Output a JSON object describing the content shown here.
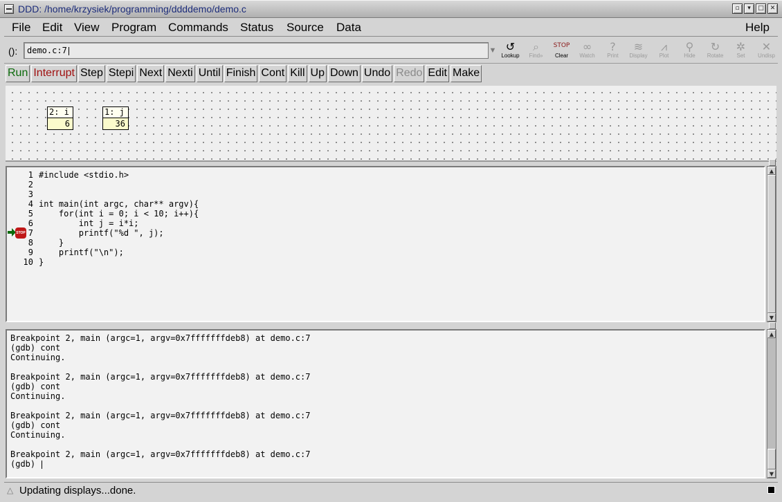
{
  "window": {
    "title": "DDD: /home/krzysiek/programming/ddddemo/demo.c",
    "controls": [
      "▫",
      "▾",
      "□",
      "✕"
    ]
  },
  "menubar": {
    "left": [
      "File",
      "Edit",
      "View",
      "Program",
      "Commands",
      "Status",
      "Source",
      "Data"
    ],
    "help": "Help"
  },
  "argument": {
    "label": "():",
    "value": "demo.c:7"
  },
  "tool_icons": [
    {
      "name": "lookup-icon",
      "glyph": "↺",
      "label": "Lookup",
      "enabled": true
    },
    {
      "name": "find-icon",
      "glyph": "⌕",
      "label": "Find»",
      "enabled": false
    },
    {
      "name": "clear-icon",
      "glyph": "STOP",
      "label": "Clear",
      "enabled": true
    },
    {
      "name": "watch-icon",
      "glyph": "∞",
      "label": "Watch",
      "enabled": false
    },
    {
      "name": "print-icon",
      "glyph": "?",
      "label": "Print",
      "enabled": false
    },
    {
      "name": "display-icon",
      "glyph": "≋",
      "label": "Display",
      "enabled": false
    },
    {
      "name": "plot-icon",
      "glyph": "⩘",
      "label": "Plot",
      "enabled": false
    },
    {
      "name": "hide-icon",
      "glyph": "⚲",
      "label": "Hide",
      "enabled": false
    },
    {
      "name": "rotate-icon",
      "glyph": "↻",
      "label": "Rotate",
      "enabled": false
    },
    {
      "name": "set-icon",
      "glyph": "✲",
      "label": "Set",
      "enabled": false
    },
    {
      "name": "undisp-icon",
      "glyph": "✕",
      "label": "Undisp",
      "enabled": false
    }
  ],
  "command_buttons": [
    {
      "label": "Run",
      "style": "run"
    },
    {
      "label": "Interrupt",
      "style": "interrupt"
    },
    {
      "label": "Step",
      "style": ""
    },
    {
      "label": "Stepi",
      "style": ""
    },
    {
      "label": "Next",
      "style": ""
    },
    {
      "label": "Nexti",
      "style": ""
    },
    {
      "label": "Until",
      "style": ""
    },
    {
      "label": "Finish",
      "style": ""
    },
    {
      "label": "Cont",
      "style": ""
    },
    {
      "label": "Kill",
      "style": ""
    },
    {
      "label": "Up",
      "style": ""
    },
    {
      "label": "Down",
      "style": ""
    },
    {
      "label": "Undo",
      "style": ""
    },
    {
      "label": "Redo",
      "style": "disabled"
    },
    {
      "label": "Edit",
      "style": ""
    },
    {
      "label": "Make",
      "style": ""
    }
  ],
  "displays": [
    {
      "header": "2: i",
      "value": "6"
    },
    {
      "header": "1: j",
      "value": "36"
    }
  ],
  "source": {
    "lines": [
      {
        "num": "1",
        "text": "#include <stdio.h>"
      },
      {
        "num": "2",
        "text": ""
      },
      {
        "num": "3",
        "text": ""
      },
      {
        "num": "4",
        "text": "int main(int argc, char** argv){"
      },
      {
        "num": "5",
        "text": "    for(int i = 0; i < 10; i++){"
      },
      {
        "num": "6",
        "text": "        int j = i*i;"
      },
      {
        "num": "7",
        "text": "        printf(\"%d \", j);"
      },
      {
        "num": "8",
        "text": "    }"
      },
      {
        "num": "9",
        "text": "    printf(\"\\n\");"
      },
      {
        "num": "10",
        "text": "}"
      }
    ],
    "breakpoint_label": "STOP"
  },
  "gdb_console": {
    "lines": [
      "Breakpoint 2, main (argc=1, argv=0x7fffffffdeb8) at demo.c:7",
      "(gdb) cont",
      "Continuing.",
      "",
      "Breakpoint 2, main (argc=1, argv=0x7fffffffdeb8) at demo.c:7",
      "(gdb) cont",
      "Continuing.",
      "",
      "Breakpoint 2, main (argc=1, argv=0x7fffffffdeb8) at demo.c:7",
      "(gdb) cont",
      "Continuing.",
      "",
      "Breakpoint 2, main (argc=1, argv=0x7fffffffdeb8) at demo.c:7",
      "(gdb) "
    ]
  },
  "status": {
    "icon": "△",
    "text": "Updating displays...done."
  }
}
